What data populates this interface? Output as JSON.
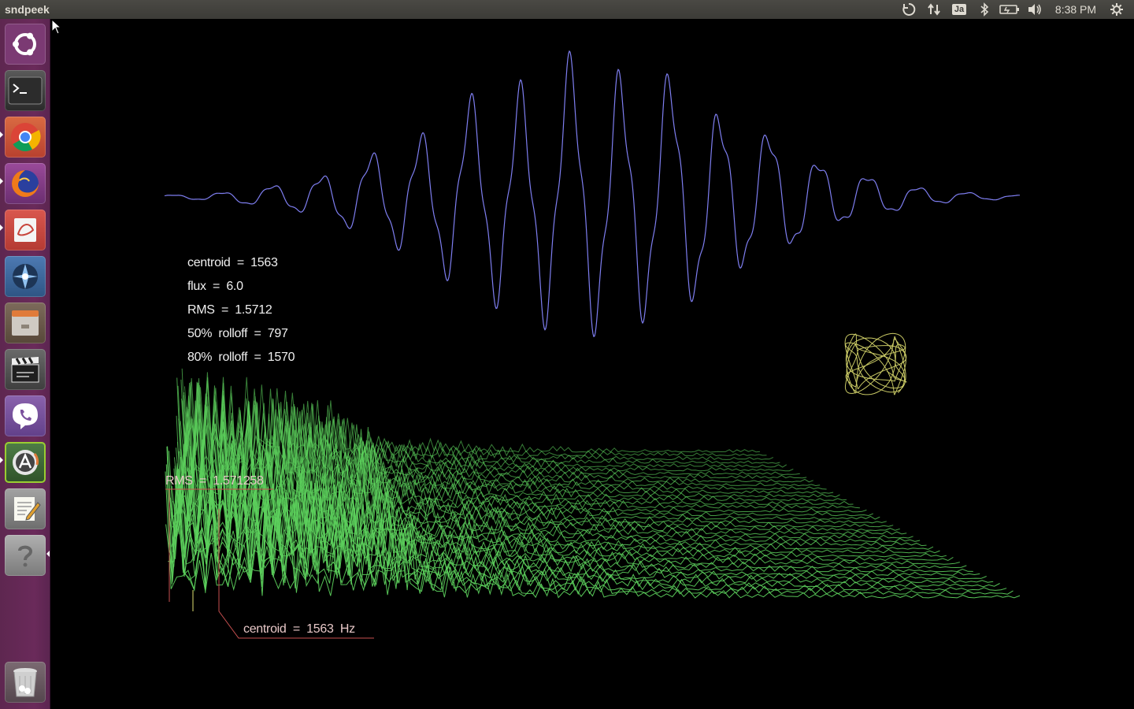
{
  "panel": {
    "app_title": "sndpeek",
    "keyboard_layout": "Ja",
    "clock": "8:38 PM",
    "indicators": [
      "network-icon",
      "transfer-icon",
      "keyboard-icon",
      "bluetooth-icon",
      "battery-icon",
      "volume-icon",
      "power-gear-icon"
    ]
  },
  "launcher": {
    "items": [
      {
        "name": "ubuntu-dash-icon",
        "bg": "#7a3b74"
      },
      {
        "name": "terminal-icon",
        "bg": "#3a3a3a"
      },
      {
        "name": "chrome-icon",
        "bg": "#c9533a"
      },
      {
        "name": "firefox-icon",
        "bg": "#8e3d8a"
      },
      {
        "name": "document-viewer-icon",
        "bg": "#c8453c"
      },
      {
        "name": "shotwell-icon",
        "bg": "#3e6aa0"
      },
      {
        "name": "files-icon",
        "bg": "#6e5d4f"
      },
      {
        "name": "video-editor-icon",
        "bg": "#5d5d5d"
      },
      {
        "name": "viber-icon",
        "bg": "#7b519d"
      },
      {
        "name": "software-updater-icon",
        "bg": "#3f6a3a"
      },
      {
        "name": "text-editor-icon",
        "bg": "#8a8a8a"
      },
      {
        "name": "help-icon",
        "bg": "#9a9a9a"
      },
      {
        "name": "trash-icon",
        "bg": "#6a5a62"
      }
    ]
  },
  "stats": {
    "centroid": "centroid  =  1563",
    "flux": "flux  =  6.0",
    "rms": "RMS  =  1.5712",
    "rolloff50": "50%  rolloff  =  797",
    "rolloff80": "80%  rolloff  =  1570",
    "rms_marker": "RMS  =  1.571258",
    "centroid_marker": "centroid  =  1563  Hz"
  },
  "colors": {
    "waveform": "#7e7ef0",
    "spectrum": "#5cd05c",
    "lissajous": "#c8c864",
    "marker_line": "#c85050"
  }
}
